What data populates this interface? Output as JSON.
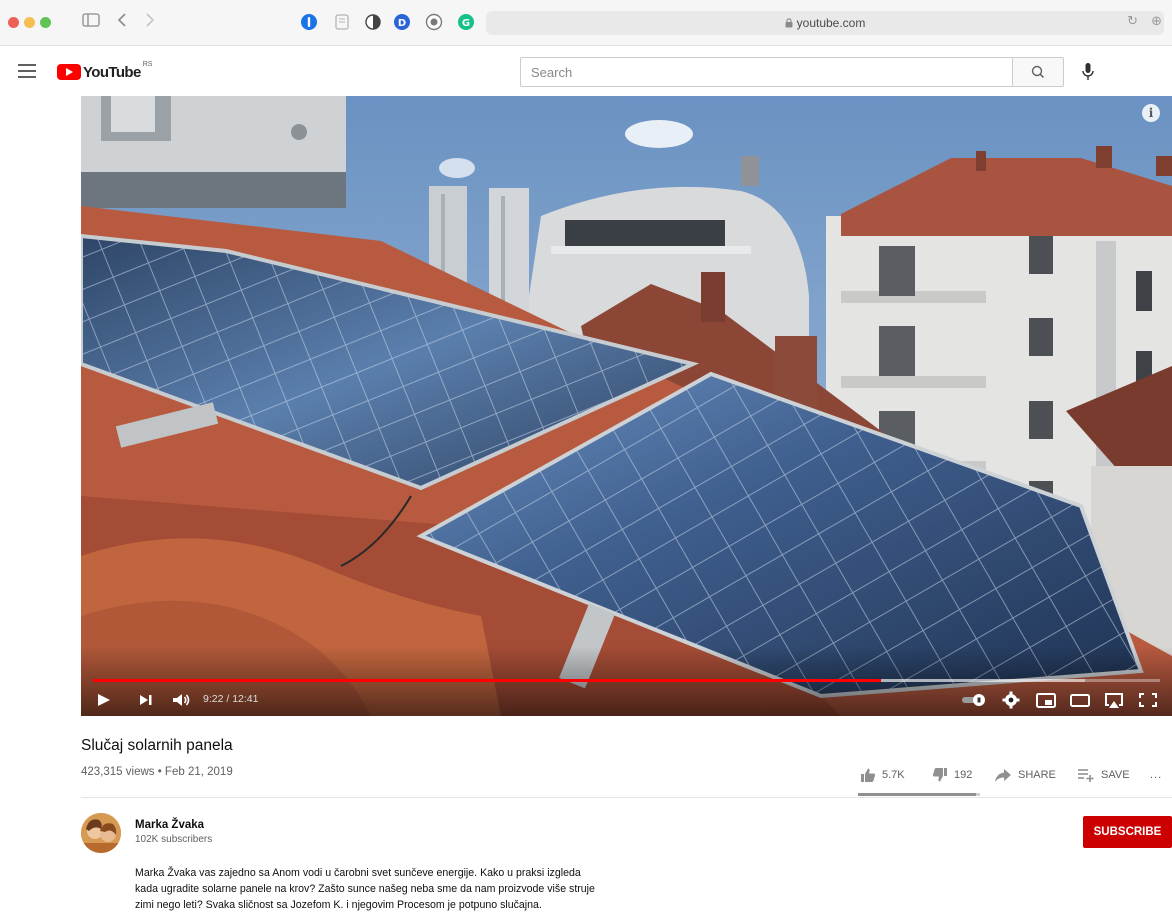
{
  "browser": {
    "url": "youtube.com",
    "extensions": [
      {
        "icon": "onepassword-icon",
        "color": "#1a73e8"
      },
      {
        "icon": "reader-icon",
        "color": "#d0d0d0"
      },
      {
        "icon": "contrast-icon",
        "color": "#555555"
      },
      {
        "icon": "d-extension-icon",
        "color": "#2a64d8"
      },
      {
        "icon": "privacy-extension-icon",
        "color": "#7a7a7a"
      },
      {
        "icon": "grammarly-icon",
        "color": "#16c08a"
      }
    ]
  },
  "header": {
    "logo_text": "YouTube",
    "logo_country": "RS",
    "search_placeholder": "Search"
  },
  "player": {
    "time": "9:22 / 12:41",
    "progress_fraction": 0.7385,
    "loaded_fraction": 0.93,
    "accent": "#ff0000"
  },
  "video": {
    "title": "Slučaj solarnih panela",
    "meta": "423,315 views • Feb 21, 2019",
    "likes": "5.7K",
    "dislikes": "192",
    "like_ratio": 0.9675,
    "share_label": "SHARE",
    "save_label": "SAVE",
    "more_label": "..."
  },
  "channel": {
    "name": "Marka Žvaka",
    "subscribers": "102K subscribers",
    "subscribe_label": "SUBSCRIBE",
    "description_lines": [
      "Marka Žvaka vas zajedno sa Anom vodi u čarobni svet sunčeve energije. Kako u praksi izgleda",
      "kada ugradite solarne panele na krov? Zašto sunce našeg neba sme da nam proizvode više struje",
      "zimi nego leti? Svaka sličnost sa Jozefom K. i njegovim Procesom je potpuno slučajna."
    ]
  }
}
